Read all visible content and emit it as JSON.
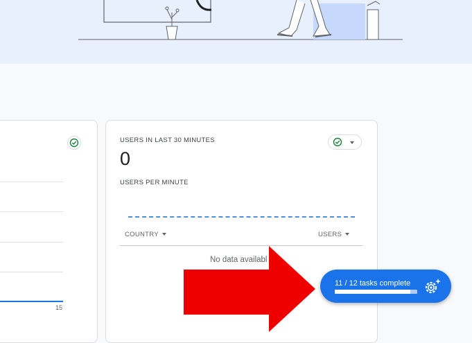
{
  "left_card": {
    "axis_tick": "15"
  },
  "realtime_card": {
    "users_heading": "USERS IN LAST 30 MINUTES",
    "users_value": "0",
    "per_minute_heading": "USERS PER MINUTE",
    "table": {
      "country_header": "COUNTRY",
      "users_header": "USERS",
      "empty_message": "No data availabl"
    }
  },
  "setup_assistant": {
    "label": "11 / 12 tasks complete",
    "progress": 0.917,
    "icon": "gear-sparkle-icon"
  },
  "colors": {
    "accent": "#1a73e8",
    "success": "#188038",
    "annotation_arrow": "#ee0000",
    "hero_background": "#e8f0fe"
  }
}
